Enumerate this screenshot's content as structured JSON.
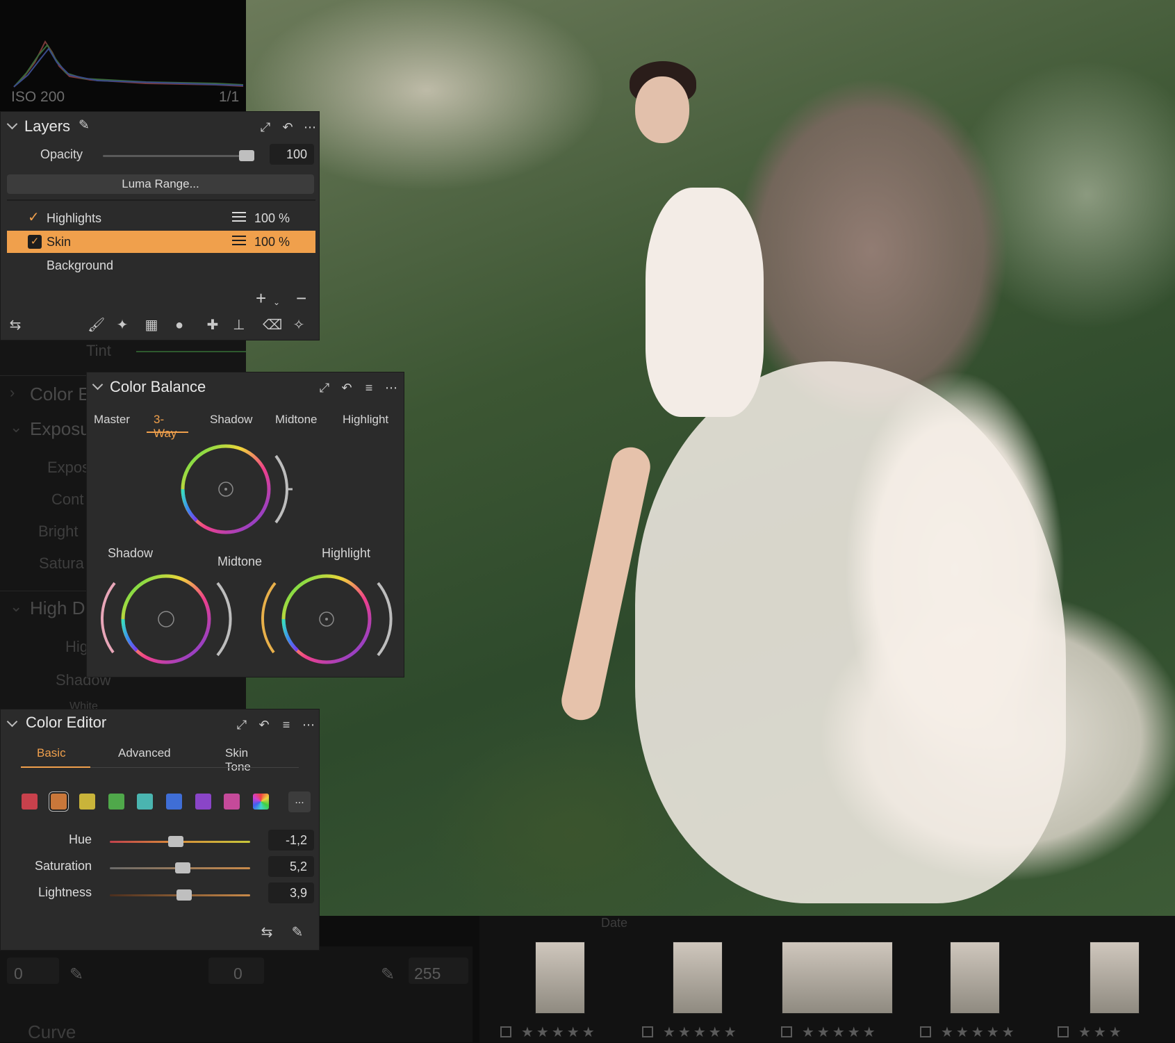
{
  "histogram": {
    "iso": "ISO 200",
    "shutter": "1/1"
  },
  "background_panels": {
    "tint_label": "Tint",
    "color_label": "Color E",
    "exposure_label": "Exposu",
    "exposure_items": [
      "Expos",
      "Cont",
      "Bright",
      "Satura"
    ],
    "hdr_label": "High D",
    "hdr_items": [
      "Highl",
      "Shadow",
      "White"
    ],
    "curve_label": "Curve",
    "levels": {
      "in_min": "0",
      "mid": "0",
      "in_max": "255"
    },
    "filmstrip_sort": "Date"
  },
  "layers": {
    "title": "Layers",
    "opacity_label": "Opacity",
    "opacity_value": "100",
    "opacity_level": 0.95,
    "luma_button": "Luma Range...",
    "items": [
      {
        "name": "Highlights",
        "checked": true,
        "percent": "100 %"
      },
      {
        "name": "Skin",
        "checked": true,
        "percent": "100 %",
        "selected": true
      },
      {
        "name": "Background",
        "checked": false,
        "percent": ""
      }
    ],
    "add_symbol": "+",
    "remove_symbol": "−"
  },
  "color_balance": {
    "title": "Color Balance",
    "tabs": [
      "Master",
      "3-Way",
      "Shadow",
      "Midtone",
      "Highlight"
    ],
    "active_tab": "3-Way",
    "wheels": {
      "shadow": "Shadow",
      "midtone": "Midtone",
      "highlight": "Highlight"
    }
  },
  "color_editor": {
    "title": "Color Editor",
    "tabs": [
      "Basic",
      "Advanced",
      "Skin Tone"
    ],
    "active_tab": "Basic",
    "swatches": [
      "#c8414c",
      "#c9773a",
      "#c9b43a",
      "#4fa84a",
      "#4ab5b0",
      "#3f6ed6",
      "#8a45c8",
      "#c54a9a"
    ],
    "selected_swatch": 1,
    "more_label": "...",
    "sliders": [
      {
        "label": "Hue",
        "value": "-1,2",
        "level": 0.47
      },
      {
        "label": "Saturation",
        "value": "5,2",
        "level": 0.52
      },
      {
        "label": "Lightness",
        "value": "3,9",
        "level": 0.53
      }
    ]
  },
  "colors": {
    "accent": "#f0a04c",
    "panel": "#2b2b2b",
    "field": "#1f1f1f"
  }
}
